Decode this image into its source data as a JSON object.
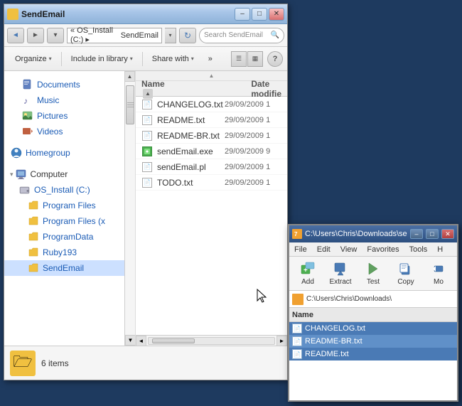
{
  "explorer": {
    "title": "SendEmail",
    "address": {
      "breadcrumbs": [
        "OS_Install (C:)",
        "SendEmail"
      ],
      "placeholder": "Search SendEmail"
    },
    "toolbar": {
      "organize": "Organize",
      "include_library": "Include in library",
      "share_with": "Share with"
    },
    "sidebar": {
      "items": [
        {
          "label": "Documents",
          "type": "folder"
        },
        {
          "label": "Music",
          "type": "music"
        },
        {
          "label": "Pictures",
          "type": "pictures"
        },
        {
          "label": "Videos",
          "type": "video"
        },
        {
          "label": "Homegroup",
          "type": "home"
        },
        {
          "label": "Computer",
          "type": "computer"
        },
        {
          "label": "OS_Install (C:)",
          "type": "drive"
        },
        {
          "label": "Program Files",
          "type": "folder"
        },
        {
          "label": "Program Files (x",
          "type": "folder"
        },
        {
          "label": "ProgramData",
          "type": "folder"
        },
        {
          "label": "Ruby193",
          "type": "folder"
        },
        {
          "label": "SendEmail",
          "type": "folder",
          "selected": true
        }
      ]
    },
    "columns": {
      "name": "Name",
      "date": "Date modifie"
    },
    "files": [
      {
        "name": "CHANGELOG.txt",
        "type": "txt",
        "date": "29/09/2009 1"
      },
      {
        "name": "README.txt",
        "type": "txt",
        "date": "29/09/2009 1"
      },
      {
        "name": "README-BR.txt",
        "type": "txt",
        "date": "29/09/2009 1"
      },
      {
        "name": "sendEmail.exe",
        "type": "exe",
        "date": "29/09/2009 9"
      },
      {
        "name": "sendEmail.pl",
        "type": "pl",
        "date": "29/09/2009 1"
      },
      {
        "name": "TODO.txt",
        "type": "txt",
        "date": "29/09/2009 1"
      }
    ],
    "status": {
      "count": "6 items"
    }
  },
  "zip_window": {
    "title": "C:\\Users\\Chris\\Downloads\\sendEmai",
    "menu": [
      "File",
      "Edit",
      "View",
      "Favorites",
      "Tools",
      "H"
    ],
    "toolbar": {
      "add": "Add",
      "extract": "Extract",
      "test": "Test",
      "copy": "Copy",
      "more": "Mo"
    },
    "address": "C:\\Users\\Chris\\Downloads\\",
    "columns": {
      "name": "Name"
    },
    "files": [
      {
        "name": "CHANGELOG.txt"
      },
      {
        "name": "README-BR.txt"
      },
      {
        "name": "README.txt"
      }
    ]
  },
  "icons": {
    "back_arrow": "◄",
    "forward_arrow": "►",
    "up_arrow": "▲",
    "down_arrow": "▼",
    "refresh": "↻",
    "search": "🔍",
    "folder": "📁",
    "document": "📄",
    "minimize": "–",
    "maximize": "□",
    "close": "✕",
    "arrow_down": "▾",
    "arrow_right": "▸",
    "view_detail": "☰",
    "view_tile": "▦",
    "help": "?",
    "add_icon": "+",
    "zip_icon": "🗜"
  },
  "colors": {
    "accent_blue": "#4a7ab5",
    "selected_bg": "#cce0ff",
    "zip_selected": "#4a7ab5"
  }
}
